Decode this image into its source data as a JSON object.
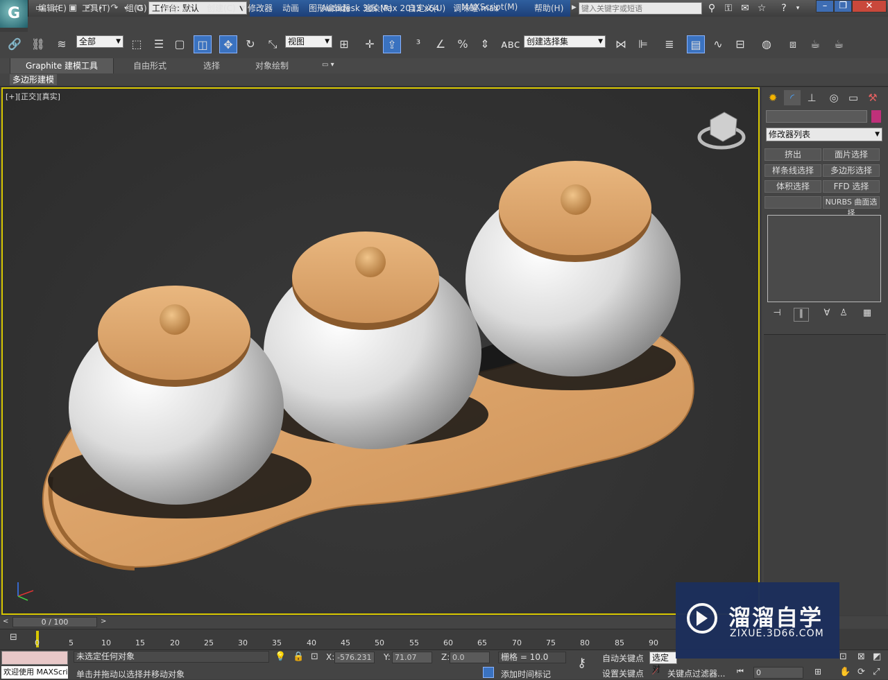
{
  "app": {
    "logo_text": "G",
    "workspace": "工作台: 默认",
    "title": "Autodesk 3ds Max  2013 x64",
    "filename": "调味罐.max",
    "search_placeholder": "键入关键字或短语"
  },
  "menus": [
    "编辑(E)",
    "工具(T)",
    "组(G)",
    "视图(V)",
    "创建(C)",
    "修改器",
    "动画",
    "图形编辑器",
    "渲染(R)",
    "自定义(U)",
    "MAXScript(M)",
    "帮助(H)"
  ],
  "toolbar": {
    "selection_filter": "全部",
    "reference_coord": "视图",
    "named_selection": "创建选择集"
  },
  "ribbon": {
    "tabs": [
      "Graphite 建模工具",
      "自由形式",
      "选择",
      "对象绘制"
    ],
    "subtab": "多边形建模"
  },
  "viewport": {
    "label": "[+][正交][真实]"
  },
  "command_panel": {
    "modifier_list": "修改器列表",
    "buttons": [
      "挤出",
      "面片选择",
      "样条线选择",
      "多边形选择",
      "体积选择",
      "FFD 选择",
      "",
      "NURBS 曲面选择"
    ]
  },
  "timeline": {
    "frame": "0 / 100",
    "ticks": [
      "0",
      "5",
      "10",
      "15",
      "20",
      "25",
      "30",
      "35",
      "40",
      "45",
      "50",
      "55",
      "60",
      "65",
      "70",
      "75",
      "80",
      "85",
      "90"
    ]
  },
  "status": {
    "maxscript_label": "欢迎使用 MAXScri",
    "selection_status": "未选定任何对象",
    "prompt": "单击并拖动以选择并移动对象",
    "x_label": "X:",
    "x_value": "-576.231",
    "y_label": "Y:",
    "y_value": "71.07",
    "z_label": "Z:",
    "z_value": "0.0",
    "grid": "栅格 = 10.0",
    "auto_key": "自动关键点",
    "set_key": "设置关键点",
    "selected_combo": "选定对",
    "add_time_tag": "添加时间标记",
    "key_filters": "关键点过滤器...",
    "frame_field": "0"
  },
  "watermark": {
    "title": "溜溜自学",
    "url": "ZIXUE.3D66.COM"
  },
  "colors": {
    "viewport_border": "#d8c800",
    "active_tool": "#3a72c0",
    "title_bar": "#1d3f78",
    "watermark_bg": "#1c2f5c"
  }
}
